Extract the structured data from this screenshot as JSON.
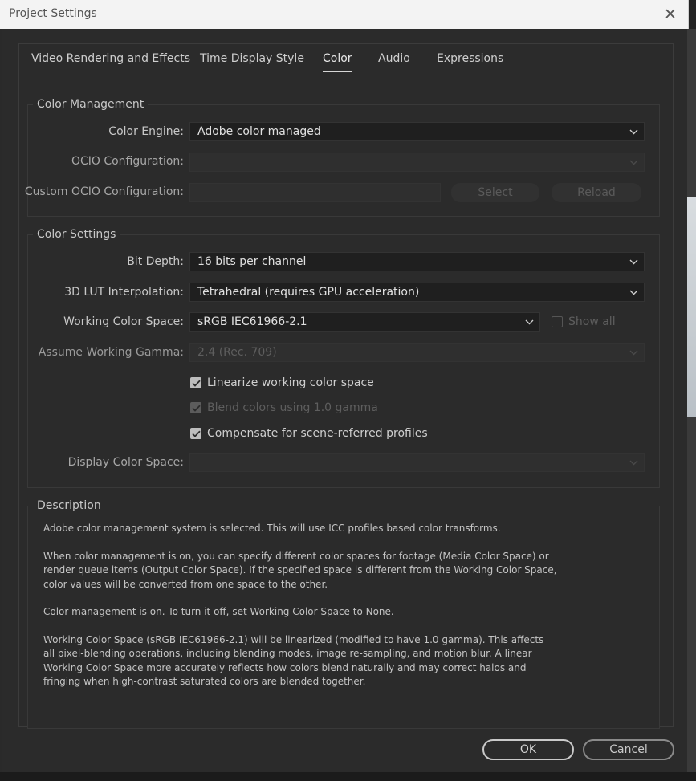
{
  "window": {
    "title": "Project Settings"
  },
  "tabs": [
    {
      "label": "Video Rendering and Effects",
      "active": false
    },
    {
      "label": "Time Display Style",
      "active": false
    },
    {
      "label": "Color",
      "active": true
    },
    {
      "label": "Audio",
      "active": false
    },
    {
      "label": "Expressions",
      "active": false
    }
  ],
  "color_management": {
    "title": "Color Management",
    "color_engine": {
      "label": "Color Engine:",
      "value": "Adobe color managed"
    },
    "ocio_configuration": {
      "label": "OCIO Configuration:",
      "value": ""
    },
    "custom_ocio_configuration": {
      "label": "Custom OCIO Configuration:",
      "value": "",
      "select_label": "Select",
      "reload_label": "Reload"
    }
  },
  "color_settings": {
    "title": "Color Settings",
    "bit_depth": {
      "label": "Bit Depth:",
      "value": "16 bits per channel"
    },
    "lut_interpolation": {
      "label": "3D LUT Interpolation:",
      "value": "Tetrahedral (requires GPU acceleration)"
    },
    "working_color_space": {
      "label": "Working Color Space:",
      "value": "sRGB IEC61966-2.1",
      "show_all_label": "Show all",
      "show_all_checked": false
    },
    "assume_working_gamma": {
      "label": "Assume Working Gamma:",
      "value": "2.4 (Rec. 709)"
    },
    "linearize": {
      "label": "Linearize working color space",
      "checked": true
    },
    "blend_colors": {
      "label": "Blend colors using 1.0 gamma",
      "checked": true,
      "disabled": true
    },
    "compensate": {
      "label": "Compensate for scene-referred profiles",
      "checked": true
    },
    "display_color_space": {
      "label": "Display Color Space:",
      "value": ""
    }
  },
  "description": {
    "title": "Description",
    "paragraphs": [
      "Adobe color management system is selected. This will use ICC profiles based color transforms.",
      "When color management is on, you can specify different color spaces for footage (Media Color Space) or render queue items (Output Color Space). If the specified space is different from the Working Color Space, color values will be converted from one space to the other.",
      "Color management is on. To turn it off, set Working Color Space to None.",
      "Working Color Space (sRGB IEC61966-2.1) will be linearized (modified to have 1.0 gamma). This affects all pixel-blending operations, including blending modes, image re-sampling, and motion blur. A linear Working Color Space more accurately reflects how colors blend naturally and may correct halos and fringing when high-contrast saturated colors are blended together."
    ]
  },
  "footer": {
    "ok_label": "OK",
    "cancel_label": "Cancel"
  },
  "icons": {
    "close": "close-icon",
    "dropdown": "chevron-down-icon",
    "check": "checkmark-icon"
  }
}
